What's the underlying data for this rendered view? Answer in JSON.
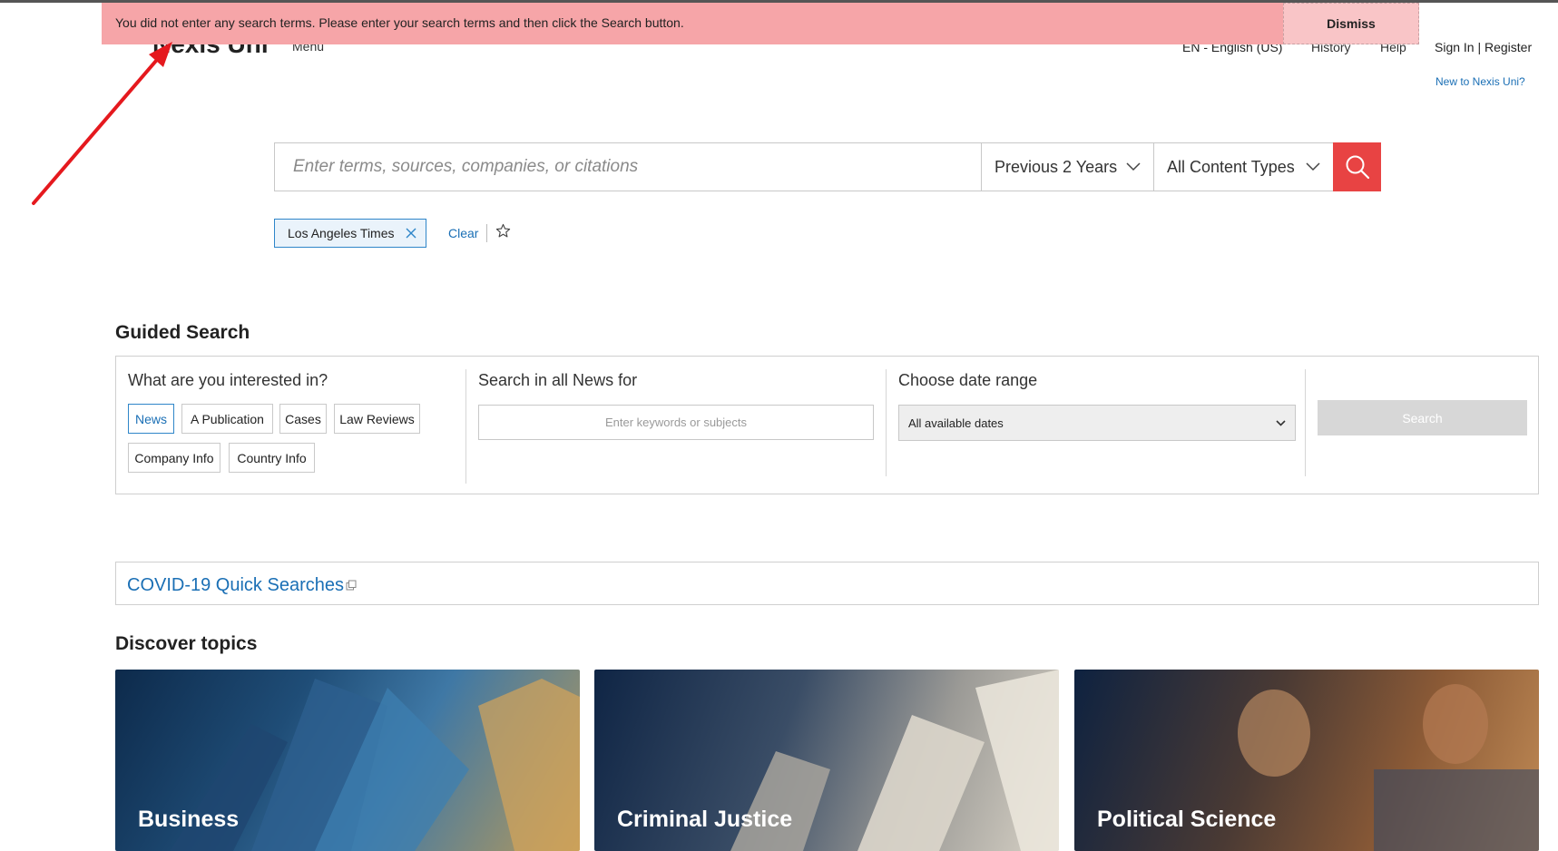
{
  "header": {
    "logo": "Nexis Uni",
    "menu": "Menu",
    "language": "EN - English (US)",
    "history": "History",
    "help": "Help",
    "signin": "Sign In | Register",
    "new_to": "New to Nexis Uni?"
  },
  "alert": {
    "message": "You did not enter any search terms. Please enter your search terms and then click the Search button.",
    "dismiss": "Dismiss",
    "color": "#f6a5a8"
  },
  "search": {
    "placeholder": "Enter terms, sources, companies, or citations",
    "date_range": "Previous 2 Years",
    "content_type": "All Content Types",
    "button_color": "#e84343"
  },
  "filters": {
    "tag": "Los Angeles Times",
    "clear": "Clear"
  },
  "guided_search": {
    "title": "Guided Search",
    "interest_title": "What are you interested in?",
    "chips": [
      "News",
      "A Publication",
      "Cases",
      "Law Reviews",
      "Company Info",
      "Country Info"
    ],
    "keywords_title": "Search in all News for",
    "keywords_placeholder": "Enter keywords or subjects",
    "date_title": "Choose date range",
    "date_value": "All available dates",
    "search_button": "Search"
  },
  "covid": {
    "link": "COVID-19 Quick Searches"
  },
  "discover": {
    "title": "Discover topics",
    "topics": [
      "Business",
      "Criminal Justice",
      "Political Science"
    ]
  },
  "icons": [
    "chevron-down-icon",
    "search-icon",
    "close-icon",
    "star-icon",
    "external-link-icon",
    "arrow-annotation"
  ]
}
